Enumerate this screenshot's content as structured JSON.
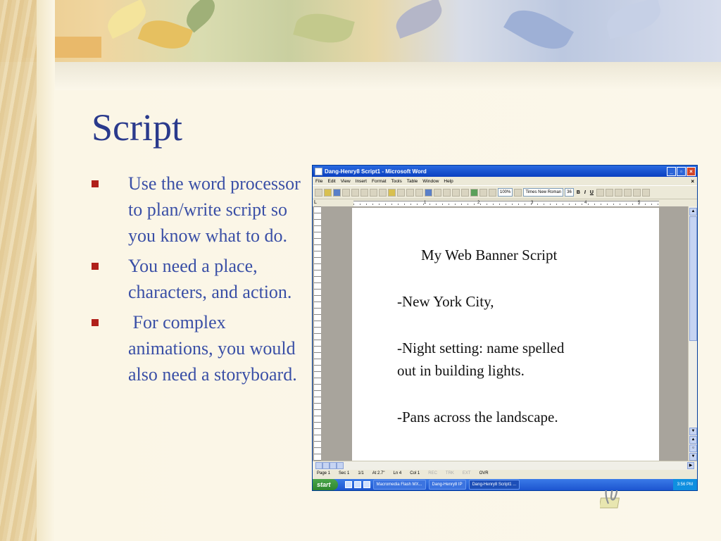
{
  "slide": {
    "title": "Script",
    "bullets": [
      "Use the word processor to plan/write script so you know what to do.",
      "You need a place, characters, and action.",
      " For complex animations, you would also need a storyboard."
    ],
    "colors": {
      "title": "#2a3a8c",
      "text": "#3a4fa6",
      "bullet": "#b0201a"
    }
  },
  "word": {
    "window_title": "Dang-Henry8 Script1 - Microsoft Word",
    "menu": [
      "File",
      "Edit",
      "View",
      "Insert",
      "Format",
      "Tools",
      "Table",
      "Window",
      "Help"
    ],
    "zoom": "100%",
    "font_name": "Times New Roman",
    "font_size": "36",
    "fmt": [
      "B",
      "I",
      "U"
    ],
    "ruler_nums": [
      "1",
      "2",
      "3",
      "4",
      "5"
    ],
    "document_lines": [
      "My Web Banner Script",
      "-New York City,",
      "-Night setting: name spelled",
      "out in building lights.",
      "-Pans across the landscape."
    ],
    "status": {
      "page": "Page 1",
      "sec": "Sec 1",
      "pages": "1/1",
      "at": "At 2.7\"",
      "ln": "Ln 4",
      "col": "Col 1",
      "rec": "REC",
      "trk": "TRK",
      "ext": "EXT",
      "ovr": "OVR"
    }
  },
  "taskbar": {
    "start": "start",
    "tasks": [
      "Macromedia Flash MX...",
      "Dang-Henry8 IP",
      "Dang-Henry8 Script1 ..."
    ],
    "clock": "3:56 PM"
  }
}
